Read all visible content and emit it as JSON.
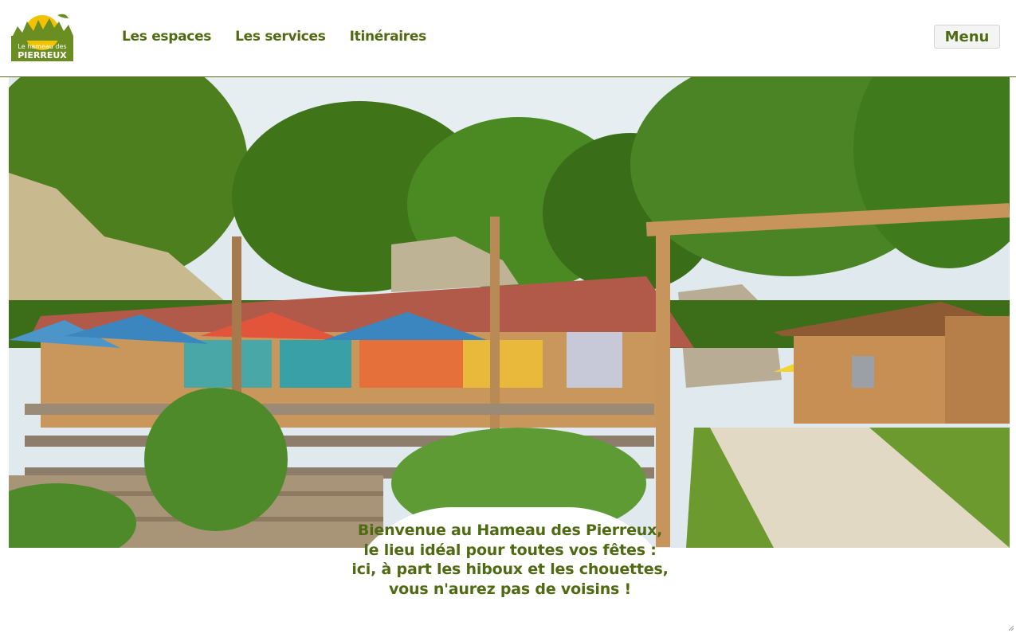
{
  "logo": {
    "line1": "Le hameau des",
    "line2": "PIERREUX"
  },
  "nav": {
    "items": [
      {
        "label": "Les espaces"
      },
      {
        "label": "Les services"
      },
      {
        "label": "Itinéraires"
      }
    ]
  },
  "menu_button": {
    "label": "Menu"
  },
  "hero": {
    "image_subject": "venue-photo"
  },
  "welcome": {
    "text": "Bienvenue au Hameau des Pierreux, le lieu idéal pour toutes vos fêtes : ici, à part les hiboux et les chouettes, vous n'aurez pas de voisins !"
  },
  "colors": {
    "brand_green": "#4f6b12",
    "logo_green": "#6b8e23",
    "logo_yellow": "#f2c200"
  }
}
